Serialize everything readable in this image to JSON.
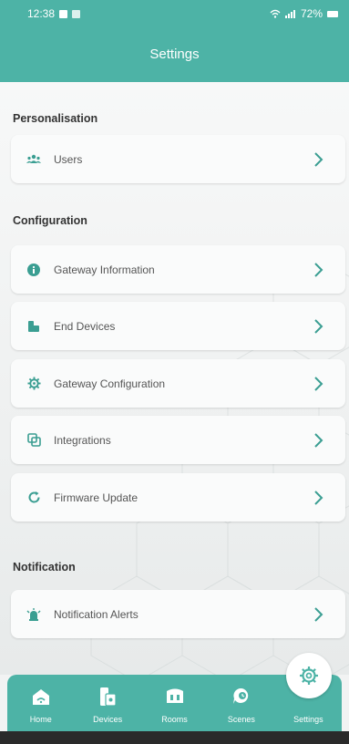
{
  "status_bar": {
    "time": "12:38",
    "battery": "72%"
  },
  "header": {
    "title": "Settings"
  },
  "sections": [
    {
      "title": "Personalisation",
      "items": [
        {
          "label": "Users",
          "icon": "users-icon"
        }
      ]
    },
    {
      "title": "Configuration",
      "items": [
        {
          "label": "Gateway Information",
          "icon": "info-icon"
        },
        {
          "label": "End Devices",
          "icon": "devices-icon"
        },
        {
          "label": "Gateway Configuration",
          "icon": "gear-icon"
        },
        {
          "label": "Integrations",
          "icon": "integrations-icon"
        },
        {
          "label": "Firmware Update",
          "icon": "refresh-icon"
        }
      ]
    },
    {
      "title": "Notification",
      "items": [
        {
          "label": "Notification Alerts",
          "icon": "alert-icon"
        }
      ]
    }
  ],
  "bottom_nav": {
    "items": [
      {
        "label": "Home",
        "icon": "home-icon"
      },
      {
        "label": "Devices",
        "icon": "devices-icon"
      },
      {
        "label": "Rooms",
        "icon": "rooms-icon"
      },
      {
        "label": "Scenes",
        "icon": "scenes-icon"
      },
      {
        "label": "Settings",
        "icon": "settings-icon",
        "active": true
      }
    ]
  },
  "colors": {
    "accent": "#4db3a6",
    "icon_teal": "#3a9e92",
    "chevron": "#3a9e92"
  }
}
